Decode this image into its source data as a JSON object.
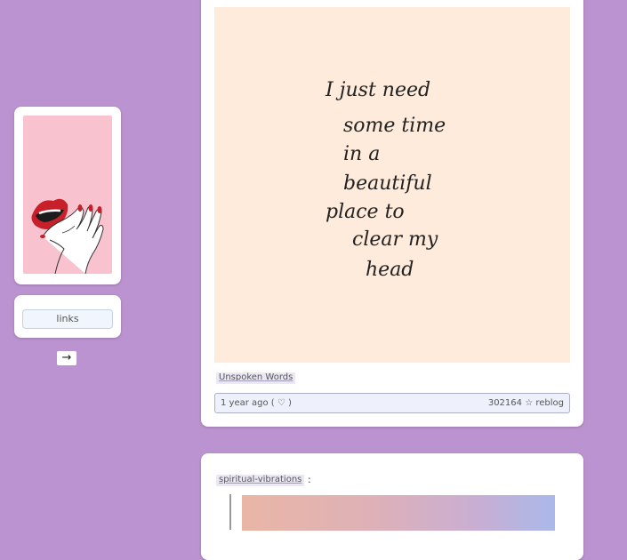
{
  "sidebar": {
    "links_label": "links",
    "next_arrow": "→"
  },
  "posts": [
    {
      "image_text_lines": [
        "I just need",
        "some time",
        "in a",
        "beautiful",
        "place to",
        "clear my",
        "head"
      ],
      "tag": "Unspoken Words",
      "timestamp": "1 year ago",
      "like_icon": "♡",
      "notes": "302164",
      "star_icon": "☆",
      "reblog_label": "reblog"
    },
    {
      "source_tag": "spiritual-vibrations",
      "separator": ":"
    }
  ],
  "colors": {
    "background": "#bb93d0",
    "card": "#ffffff",
    "avatar_bg": "#f8c2cf",
    "quote_image_bg": "#feebdb",
    "lips": "#c8202a"
  }
}
